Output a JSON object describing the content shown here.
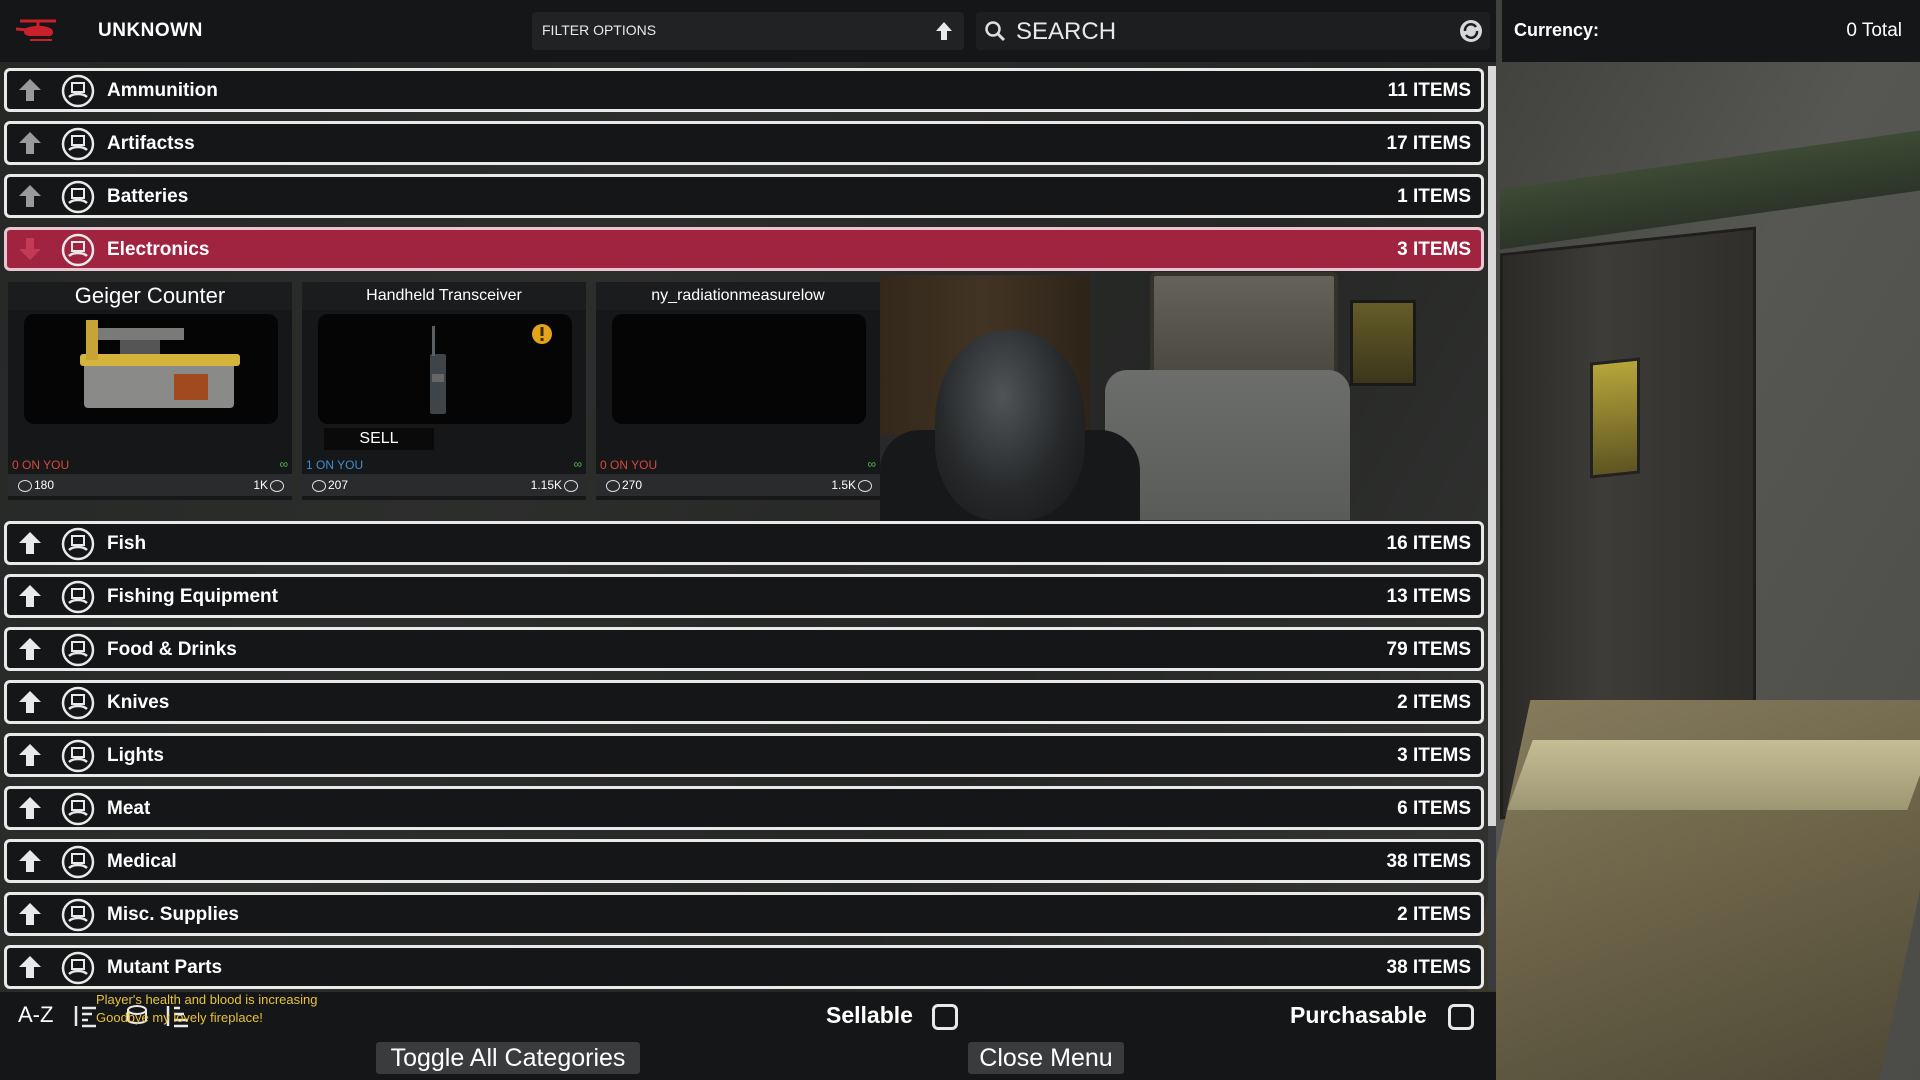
{
  "header": {
    "trader_name": "UNKNOWN",
    "filter_label": "FILTER OPTIONS",
    "search_placeholder": "SEARCH"
  },
  "currency": {
    "label": "Currency:",
    "value": "0 Total"
  },
  "categories": [
    {
      "name": "Ammunition",
      "count": "11 ITEMS"
    },
    {
      "name": "Artifactss",
      "count": "17 ITEMS"
    },
    {
      "name": "Batteries",
      "count": "1 ITEMS"
    },
    {
      "name": "Electronics",
      "count": "3 ITEMS"
    },
    {
      "name": "Fish",
      "count": "16 ITEMS"
    },
    {
      "name": "Fishing Equipment",
      "count": "13 ITEMS"
    },
    {
      "name": "Food & Drinks",
      "count": "79 ITEMS"
    },
    {
      "name": "Knives",
      "count": "2 ITEMS"
    },
    {
      "name": "Lights",
      "count": "3 ITEMS"
    },
    {
      "name": "Meat",
      "count": "6 ITEMS"
    },
    {
      "name": "Medical",
      "count": "38 ITEMS"
    },
    {
      "name": "Misc. Supplies",
      "count": "2 ITEMS"
    },
    {
      "name": "Mutant Parts",
      "count": "38 ITEMS"
    }
  ],
  "items": [
    {
      "title": "Geiger Counter",
      "on_you": "0 ON YOU",
      "buy": "180",
      "sell": "1K"
    },
    {
      "title": "Handheld Transceiver",
      "on_you": "1 ON YOU",
      "buy": "207",
      "sell": "1.15K",
      "sell_button": "SELL"
    },
    {
      "title": "ny_radiationmeasurelow",
      "on_you": "0 ON YOU",
      "buy": "270",
      "sell": "1.5K"
    }
  ],
  "footer": {
    "sort_label": "A-Z",
    "sellable_label": "Sellable",
    "purchasable_label": "Purchasable",
    "toggle_label": "Toggle All Categories",
    "close_label": "Close Menu",
    "chat": [
      "Player's health and blood is increasing",
      "Goodbye my lovely fireplace!"
    ]
  },
  "colors": {
    "active_row": "#a0233f",
    "panel": "#151617",
    "zero_on_you": "#d9483b",
    "have_on_you": "#3f8fd0",
    "chat": "#e8c13a"
  },
  "icons": {
    "logo": "helicopter-icon",
    "category": "trader-hand-icon",
    "row_arrow": "arrow-up-icon"
  }
}
